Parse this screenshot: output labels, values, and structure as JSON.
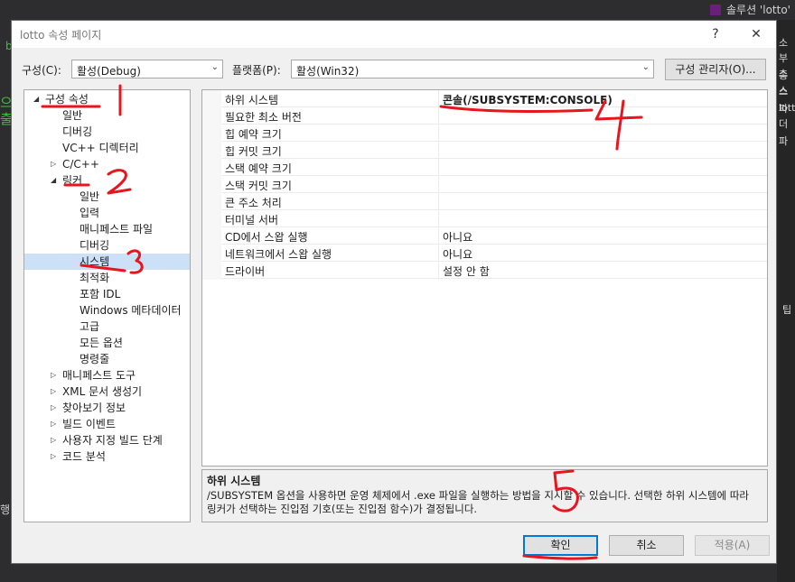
{
  "background": {
    "solution_label": "솔루션 'lotto'",
    "right_fragments": [
      "소",
      "부 종",
      "스스",
      "스 파",
      "lotto",
      "더 파"
    ],
    "right_fragment_tip": "팁",
    "left_fragments": [
      "으",
      "출"
    ],
    "left_fragment_b": "b",
    "left_fragment_hang": "행"
  },
  "dialog": {
    "title": "lotto 속성 페이지",
    "help_label": "?",
    "close_label": "✕",
    "config_label": "구성(C):",
    "config_value": "활성(Debug)",
    "platform_label": "플랫폼(P):",
    "platform_value": "활성(Win32)",
    "config_manager_label": "구성 관리자(O)..."
  },
  "tree": [
    {
      "label": "구성 속성",
      "indent": 0,
      "expander": "◢",
      "selected": false
    },
    {
      "label": "일반",
      "indent": 1,
      "expander": "",
      "selected": false
    },
    {
      "label": "디버깅",
      "indent": 1,
      "expander": "",
      "selected": false
    },
    {
      "label": "VC++ 디렉터리",
      "indent": 1,
      "expander": "",
      "selected": false
    },
    {
      "label": "C/C++",
      "indent": 1,
      "expander": "▷",
      "selected": false
    },
    {
      "label": "링커",
      "indent": 1,
      "expander": "◢",
      "selected": false
    },
    {
      "label": "일반",
      "indent": 2,
      "expander": "",
      "selected": false
    },
    {
      "label": "입력",
      "indent": 2,
      "expander": "",
      "selected": false
    },
    {
      "label": "매니페스트 파일",
      "indent": 2,
      "expander": "",
      "selected": false
    },
    {
      "label": "디버깅",
      "indent": 2,
      "expander": "",
      "selected": false
    },
    {
      "label": "시스템",
      "indent": 2,
      "expander": "",
      "selected": true
    },
    {
      "label": "최적화",
      "indent": 2,
      "expander": "",
      "selected": false
    },
    {
      "label": "포함 IDL",
      "indent": 2,
      "expander": "",
      "selected": false
    },
    {
      "label": "Windows 메타데이터",
      "indent": 2,
      "expander": "",
      "selected": false
    },
    {
      "label": "고급",
      "indent": 2,
      "expander": "",
      "selected": false
    },
    {
      "label": "모든 옵션",
      "indent": 2,
      "expander": "",
      "selected": false
    },
    {
      "label": "명령줄",
      "indent": 2,
      "expander": "",
      "selected": false
    },
    {
      "label": "매니페스트 도구",
      "indent": 1,
      "expander": "▷",
      "selected": false
    },
    {
      "label": "XML 문서 생성기",
      "indent": 1,
      "expander": "▷",
      "selected": false
    },
    {
      "label": "찾아보기 정보",
      "indent": 1,
      "expander": "▷",
      "selected": false
    },
    {
      "label": "빌드 이벤트",
      "indent": 1,
      "expander": "▷",
      "selected": false
    },
    {
      "label": "사용자 지정 빌드 단계",
      "indent": 1,
      "expander": "▷",
      "selected": false
    },
    {
      "label": "코드 분석",
      "indent": 1,
      "expander": "▷",
      "selected": false
    }
  ],
  "grid": [
    {
      "name": "하위 시스템",
      "value": "콘솔(/SUBSYSTEM:CONSOLE)",
      "bold": true
    },
    {
      "name": "필요한 최소 버전",
      "value": "",
      "bold": false
    },
    {
      "name": "힙 예약 크기",
      "value": "",
      "bold": false
    },
    {
      "name": "힙 커밋 크기",
      "value": "",
      "bold": false
    },
    {
      "name": "스택 예약 크기",
      "value": "",
      "bold": false
    },
    {
      "name": "스택 커밋 크기",
      "value": "",
      "bold": false
    },
    {
      "name": "큰 주소 처리",
      "value": "",
      "bold": false
    },
    {
      "name": "터미널 서버",
      "value": "",
      "bold": false
    },
    {
      "name": "CD에서 스왑 실행",
      "value": "아니요",
      "bold": false
    },
    {
      "name": "네트워크에서 스왑 실행",
      "value": "아니요",
      "bold": false
    },
    {
      "name": "드라이버",
      "value": "설정 안 함",
      "bold": false
    }
  ],
  "description": {
    "title": "하위 시스템",
    "text": "/SUBSYSTEM 옵션을 사용하면 운영 체제에서 .exe 파일을 실행하는 방법을 지시할 수 있습니다. 선택한 하위 시스템에 따라 링커가 선택하는 진입점 기호(또는 진입점 함수)가 결정됩니다."
  },
  "buttons": {
    "ok": "확인",
    "cancel": "취소",
    "apply": "적용(A)"
  },
  "annotations": {
    "color": "#e8141e",
    "numbers": [
      "1",
      "2",
      "3",
      "4",
      "5"
    ]
  }
}
